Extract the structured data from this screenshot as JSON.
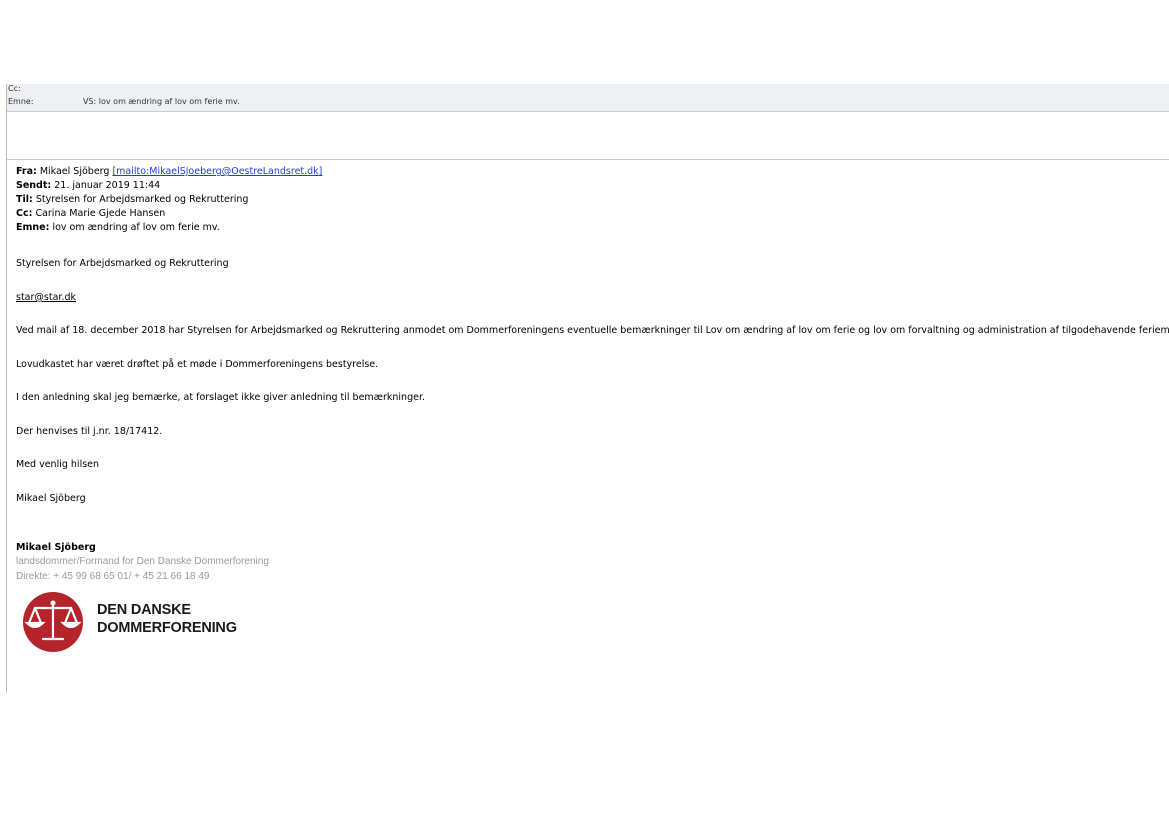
{
  "header": {
    "cc_label": "Cc:",
    "cc_value": "",
    "subject_label": "Emne:",
    "subject_value": "VS: lov om ændring af lov om ferie mv."
  },
  "quoted": {
    "from_label": "Fra:",
    "from_name": "Mikael Sjöberg",
    "from_link": "[mailto:MikaelSjoeberg@OestreLandsret.dk]",
    "sent_label": "Sendt:",
    "sent_value": "21. januar 2019 11:44",
    "to_label": "Til:",
    "to_value": "Styrelsen for Arbejdsmarked og Rekruttering",
    "cc_label": "Cc:",
    "cc_value": "Carina Marie Gjede Hansen",
    "subject_label": "Emne:",
    "subject_value": "lov om ændring af lov om ferie mv."
  },
  "body": {
    "recipient_org": "Styrelsen for Arbejdsmarked og Rekruttering",
    "recipient_email": "star@star.dk",
    "para1": "Ved mail af 18. december 2018 har Styrelsen for Arbejdsmarked og Rekruttering anmodet om Dommerforeningens eventuelle bemærkninger til Lov om ændring af lov om ferie og lov om forvaltning og administration af tilgodehavende feriemidler.",
    "para2": "Lovudkastet har været drøftet på et møde i Dommerforeningens bestyrelse.",
    "para3": "I den anledning skal jeg bemærke, at forslaget ikke giver anledning til bemærkninger.",
    "para4": "Der henvises til j.nr. 18/17412.",
    "closing": "Med venlig hilsen",
    "signer": "Mikael Sjöberg"
  },
  "signature": {
    "name": "Mikael Sjöberg",
    "title": "landsdommer/Formand for Den Danske Dommerforening",
    "phone": "Direkte: + 45 99 68 65 01/ + 45 21 66 18 49",
    "logo_line1": "DEN DANSKE",
    "logo_line2": "DOMMERFORENING",
    "logo_color": "#b3252b"
  }
}
